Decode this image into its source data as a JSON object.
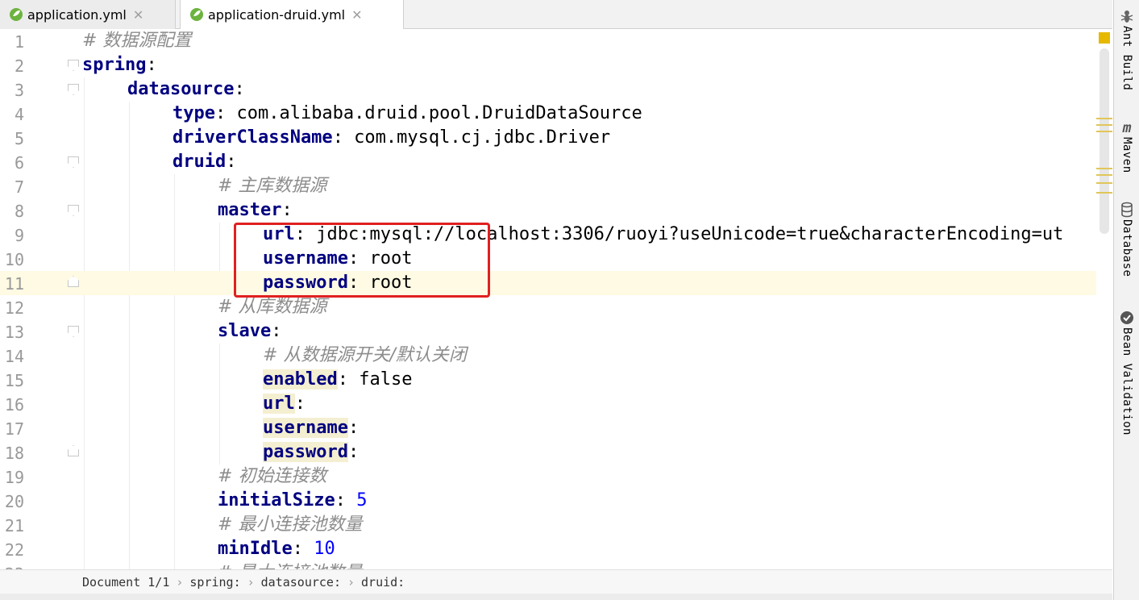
{
  "tabs": [
    {
      "label": "application.yml",
      "close": "✕"
    },
    {
      "label": "application-druid.yml",
      "close": "✕"
    }
  ],
  "tool_windows": [
    {
      "label": "Ant Build",
      "icon": "ant-icon"
    },
    {
      "label": "Maven",
      "icon": "maven-icon"
    },
    {
      "label": "Database",
      "icon": "database-icon"
    },
    {
      "label": "Bean Validation",
      "icon": "bean-validation-icon"
    }
  ],
  "editor": {
    "lines": [
      {
        "n": "1",
        "key": "",
        "text": "",
        "comment": "# 数据源配置"
      },
      {
        "n": "2",
        "key": "spring",
        "text": ":",
        "comment": ""
      },
      {
        "n": "3",
        "key": "datasource",
        "text": ":",
        "comment": ""
      },
      {
        "n": "4",
        "key": "type",
        "text": ": com.alibaba.druid.pool.DruidDataSource",
        "comment": ""
      },
      {
        "n": "5",
        "key": "driverClassName",
        "text": ": com.mysql.cj.jdbc.Driver",
        "comment": ""
      },
      {
        "n": "6",
        "key": "druid",
        "text": ":",
        "comment": ""
      },
      {
        "n": "7",
        "key": "",
        "text": "",
        "comment": "# 主库数据源"
      },
      {
        "n": "8",
        "key": "master",
        "text": ":",
        "comment": ""
      },
      {
        "n": "9",
        "key": "url",
        "text": ": jdbc:mysql://localhost:3306/ruoyi?useUnicode=true&characterEncoding=ut",
        "comment": ""
      },
      {
        "n": "10",
        "key": "username",
        "text": ": root",
        "comment": ""
      },
      {
        "n": "11",
        "key": "password",
        "text": ": root",
        "comment": ""
      },
      {
        "n": "12",
        "key": "",
        "text": "",
        "comment": "# 从库数据源"
      },
      {
        "n": "13",
        "key": "slave",
        "text": ":",
        "comment": ""
      },
      {
        "n": "14",
        "key": "",
        "text": "",
        "comment": "# 从数据源开关/默认关闭"
      },
      {
        "n": "15",
        "key": "enabled",
        "text": ": false",
        "comment": ""
      },
      {
        "n": "16",
        "key": "url",
        "text": ":",
        "comment": ""
      },
      {
        "n": "17",
        "key": "username",
        "text": ":",
        "comment": ""
      },
      {
        "n": "18",
        "key": "password",
        "text": ":",
        "comment": ""
      },
      {
        "n": "19",
        "key": "",
        "text": "",
        "comment": "# 初始连接数"
      },
      {
        "n": "20",
        "key": "initialSize",
        "text": ": ",
        "num": "5",
        "comment": ""
      },
      {
        "n": "21",
        "key": "",
        "text": "",
        "comment": "# 最小连接池数量"
      },
      {
        "n": "22",
        "key": "minIdle",
        "text": ": ",
        "num": "10",
        "comment": ""
      },
      {
        "n": "23",
        "key": "",
        "text": "",
        "comment": "# 最大连接池数量"
      }
    ]
  },
  "breadcrumb": [
    "Document 1/1",
    "spring:",
    "datasource:",
    "druid:"
  ],
  "colors": {
    "highlight_box": "#e02020",
    "current_line": "#fffae3",
    "keyword": "#000080",
    "comment": "#8c8c8c"
  }
}
